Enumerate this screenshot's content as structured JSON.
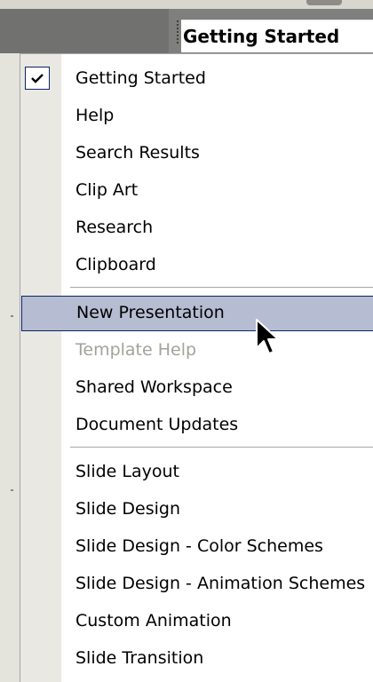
{
  "pane": {
    "title": "Getting Started"
  },
  "menu": {
    "items": [
      {
        "label": "Getting Started",
        "checked": true,
        "state": "normal"
      },
      {
        "label": "Help",
        "state": "normal"
      },
      {
        "label": "Search Results",
        "state": "normal"
      },
      {
        "label": "Clip Art",
        "state": "normal"
      },
      {
        "label": "Research",
        "state": "normal"
      },
      {
        "label": "Clipboard",
        "state": "normal"
      },
      {
        "label": "New Presentation",
        "state": "highlighted"
      },
      {
        "label": "Template Help",
        "state": "disabled"
      },
      {
        "label": "Shared Workspace",
        "state": "normal"
      },
      {
        "label": "Document Updates",
        "state": "normal"
      },
      {
        "label": "Slide Layout",
        "state": "normal"
      },
      {
        "label": "Slide Design",
        "state": "normal"
      },
      {
        "label": "Slide Design - Color Schemes",
        "state": "normal"
      },
      {
        "label": "Slide Design - Animation Schemes",
        "state": "normal"
      },
      {
        "label": "Custom Animation",
        "state": "normal"
      },
      {
        "label": "Slide Transition",
        "state": "normal"
      }
    ]
  },
  "icons": {
    "check": "checkmark-icon",
    "cursor": "mouse-pointer-icon",
    "grip": "drag-grip-icon"
  },
  "colors": {
    "highlight_fill": "#b6bdd2",
    "highlight_border": "#0a246a",
    "disabled_text": "#a3a29b",
    "gutter": "#e9e8e2"
  }
}
